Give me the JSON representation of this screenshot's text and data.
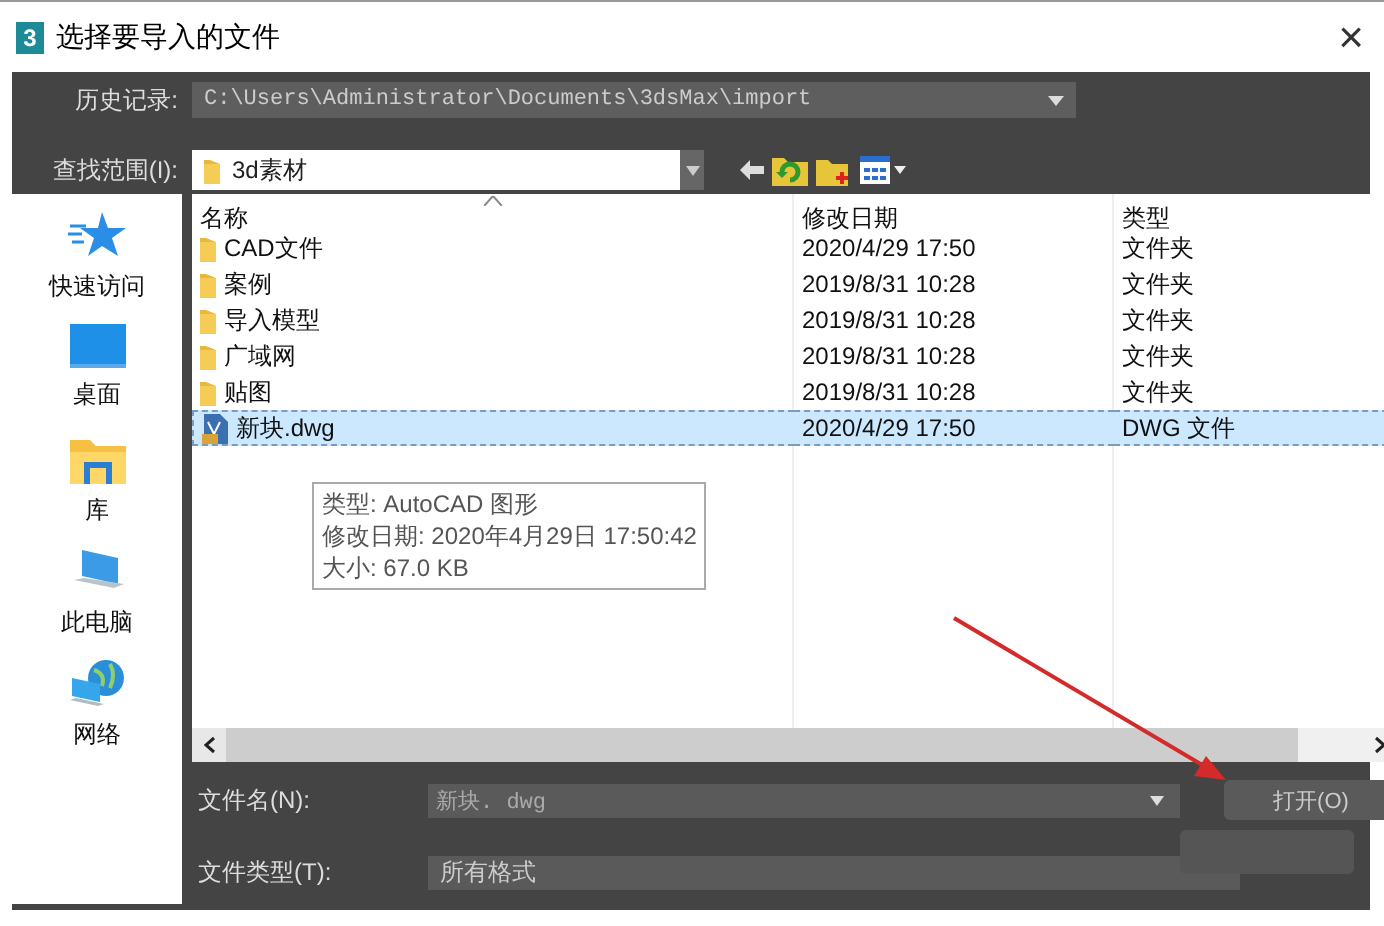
{
  "window": {
    "app_icon": "3",
    "title": "选择要导入的文件",
    "close": "×"
  },
  "history": {
    "label": "历史记录:",
    "value": "C:\\Users\\Administrator\\Documents\\3dsMax\\import"
  },
  "look_in": {
    "label": "查找范围(I):",
    "value": "3d素材"
  },
  "places": [
    {
      "label": "快速访问",
      "kind": "star"
    },
    {
      "label": "桌面",
      "kind": "desktop"
    },
    {
      "label": "库",
      "kind": "library"
    },
    {
      "label": "此电脑",
      "kind": "computer"
    },
    {
      "label": "网络",
      "kind": "network"
    }
  ],
  "files": {
    "columns": [
      "名称",
      "修改日期",
      "类型"
    ],
    "rows": [
      {
        "name": "CAD文件",
        "date": "2020/4/29 17:50",
        "type": "文件夹",
        "kind": "folder",
        "selected": false
      },
      {
        "name": "案例",
        "date": "2019/8/31 10:28",
        "type": "文件夹",
        "kind": "folder",
        "selected": false
      },
      {
        "name": "导入模型",
        "date": "2019/8/31 10:28",
        "type": "文件夹",
        "kind": "folder",
        "selected": false
      },
      {
        "name": "广域网",
        "date": "2019/8/31 10:28",
        "type": "文件夹",
        "kind": "folder",
        "selected": false
      },
      {
        "name": "贴图",
        "date": "2019/8/31 10:28",
        "type": "文件夹",
        "kind": "folder",
        "selected": false
      },
      {
        "name": "新块.dwg",
        "date": "2020/4/29 17:50",
        "type": "DWG 文件",
        "kind": "dwg",
        "selected": true
      }
    ]
  },
  "tooltip": [
    "类型: AutoCAD 图形",
    "修改日期: 2020年4月29日 17:50:42",
    "大小: 67.0 KB"
  ],
  "file_name": {
    "label": "文件名(N):",
    "value": "新块. dwg"
  },
  "file_type": {
    "label": "文件类型(T):",
    "value": "所有格式"
  },
  "open_button": {
    "label": "打开(O)"
  }
}
